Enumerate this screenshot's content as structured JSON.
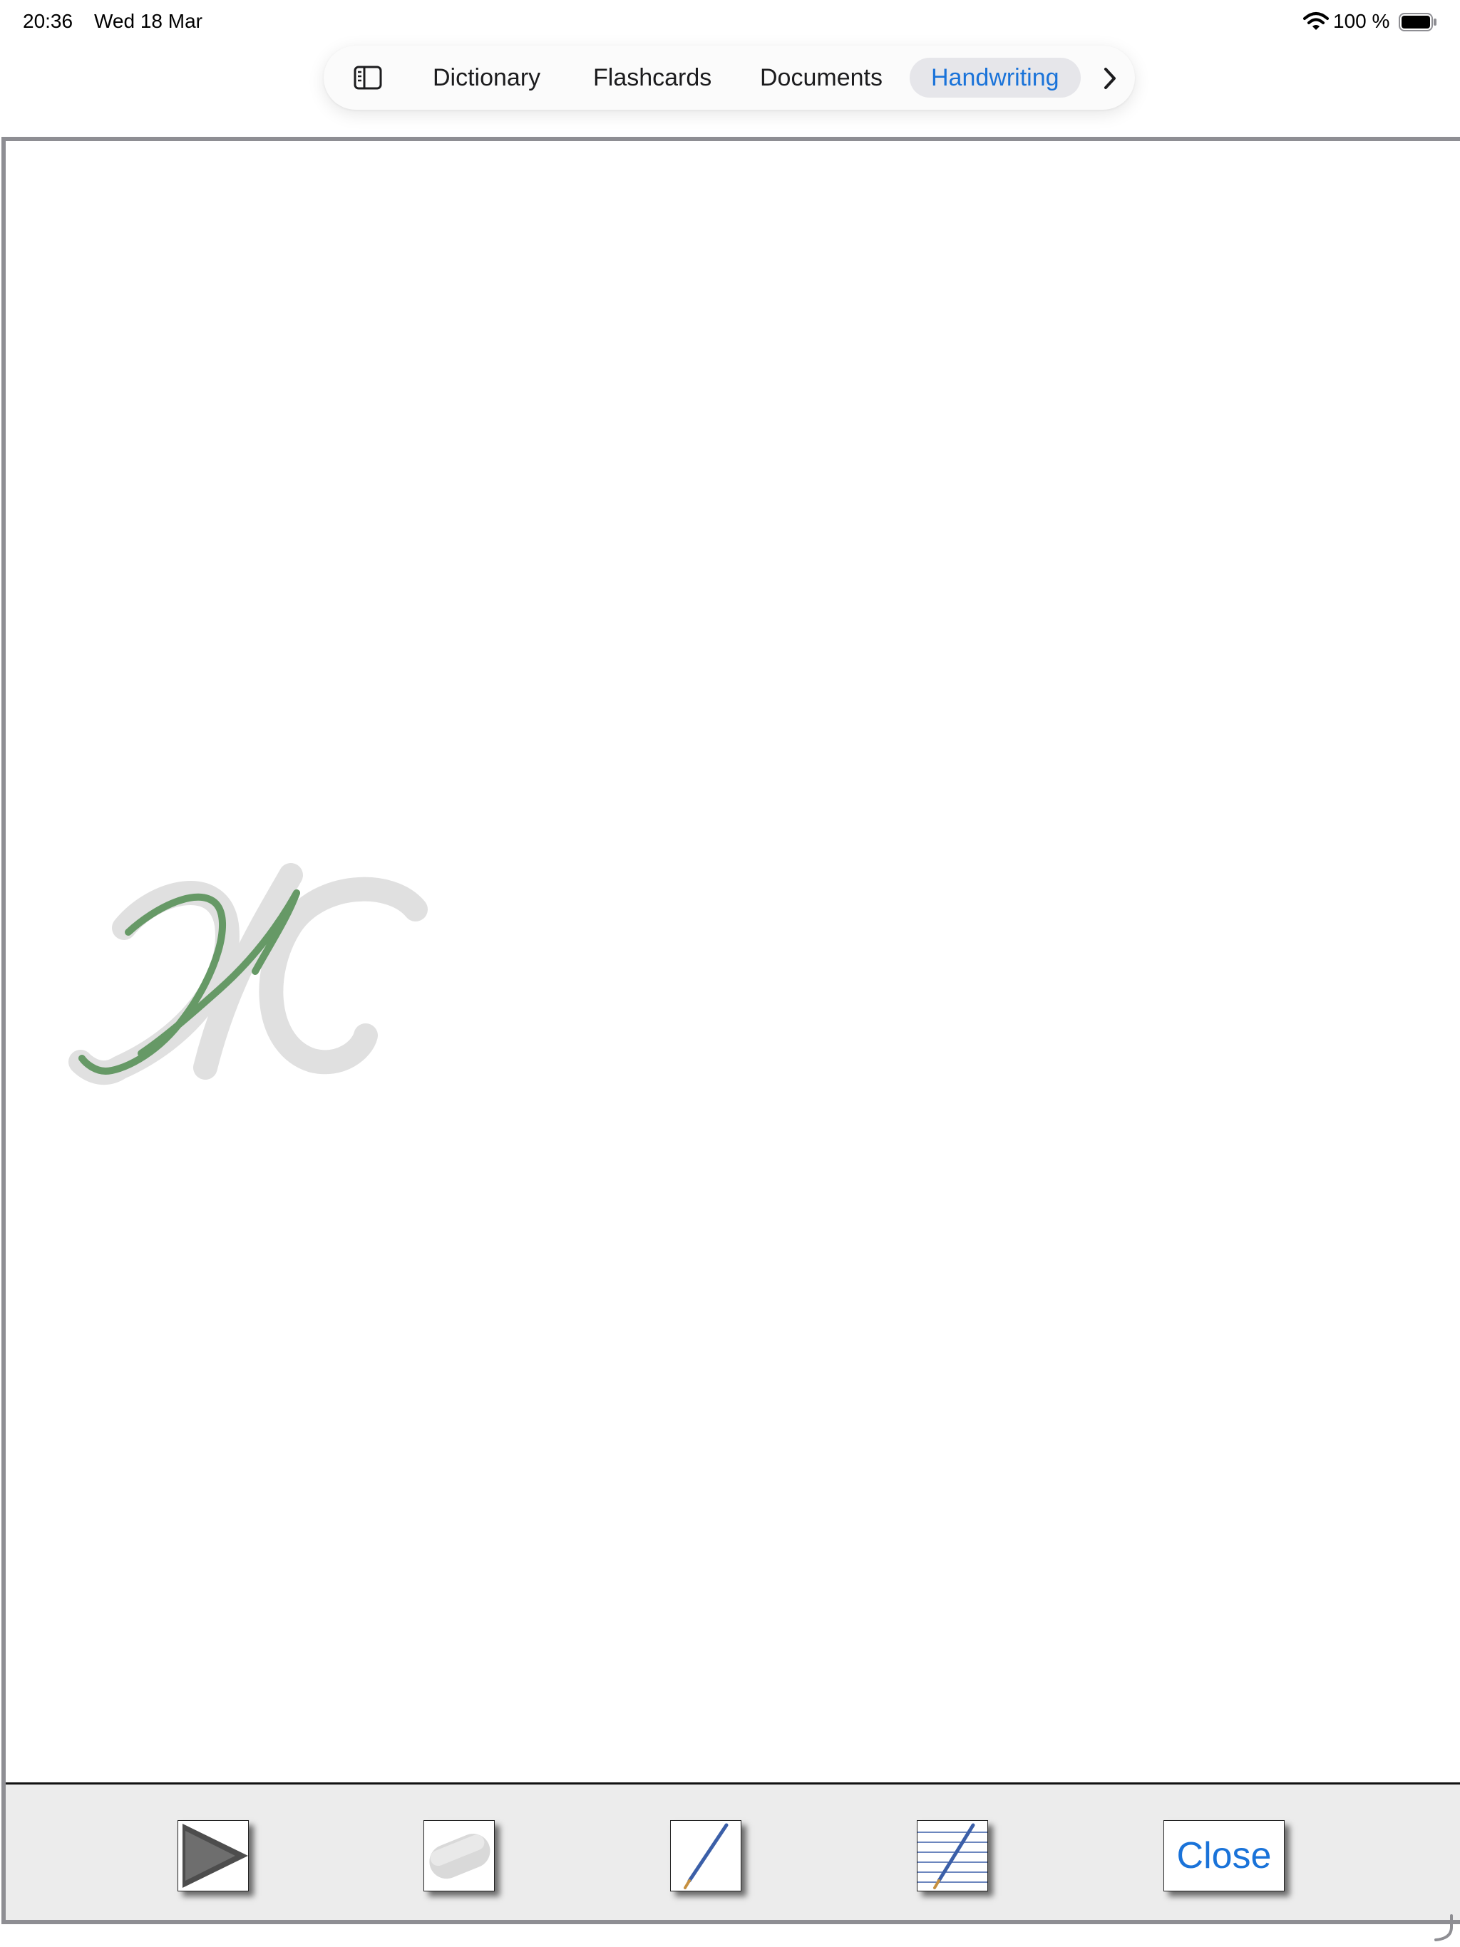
{
  "status_bar": {
    "time": "20:36",
    "date": "Wed 18 Mar",
    "battery_percent": "100 %",
    "icons": [
      "wifi-icon",
      "battery-icon"
    ]
  },
  "tabs": [
    {
      "label": "Dictionary",
      "active": false
    },
    {
      "label": "Flashcards",
      "active": false
    },
    {
      "label": "Documents",
      "active": false
    },
    {
      "label": "Handwriting",
      "active": true
    }
  ],
  "tabbar_icons": [
    "sidebar-toggle-icon",
    "chevron-right-icon"
  ],
  "toolbar": {
    "close_label": "Close",
    "tools": [
      "play-icon",
      "eraser-icon",
      "pencil-icon",
      "lined-paper-pencil-icon"
    ]
  },
  "colors": {
    "accent": "#1a73d9",
    "stroke_user": "#669966",
    "stroke_guide": "#e0e0e0",
    "toolbar_bg": "#ececec",
    "frame_border": "#8e8e93"
  }
}
